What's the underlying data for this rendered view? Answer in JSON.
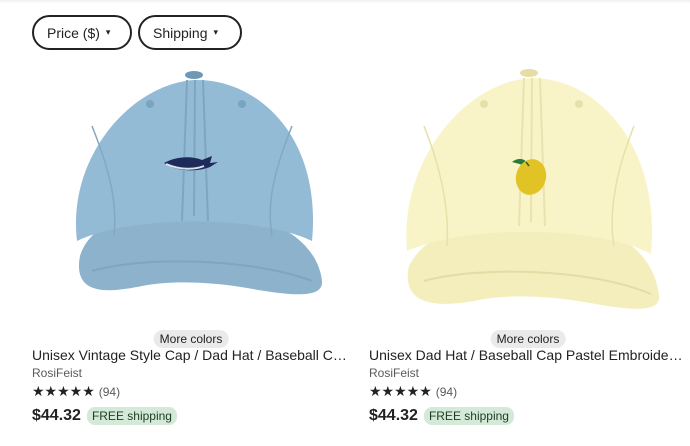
{
  "filters": [
    {
      "label": "Price ($)",
      "caret": "▾"
    },
    {
      "label": "Shipping",
      "caret": "▾"
    }
  ],
  "listings": [
    {
      "more_colors": "More colors",
      "title": "Unisex Vintage Style Cap / Dad Hat / Baseball Cap Embroidered Whale",
      "shop": "RosiFeist",
      "stars": "★★★★★",
      "rating_count": "(94)",
      "price": "$44.32",
      "shipping_badge": "FREE shipping",
      "cap_color": "#8fb7d3",
      "emblem": "whale-icon"
    },
    {
      "more_colors": "More colors",
      "title": "Unisex Dad Hat / Baseball Cap Pastel Embroidered Lemon",
      "shop": "RosiFeist",
      "stars": "★★★★★",
      "rating_count": "(94)",
      "price": "$44.32",
      "shipping_badge": "FREE shipping",
      "cap_color": "#f6f2c2",
      "emblem": "lemon-icon"
    }
  ]
}
